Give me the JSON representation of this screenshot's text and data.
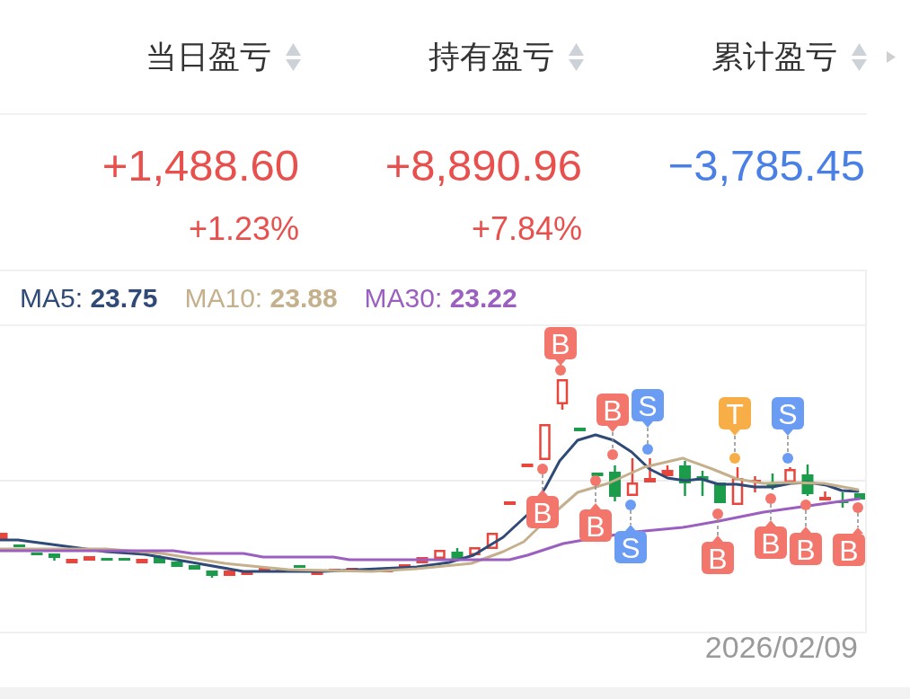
{
  "columns": [
    {
      "label": "当日盈亏",
      "value": "+1,488.60",
      "percent": "+1.23%",
      "color": "#e8504d"
    },
    {
      "label": "持有盈亏",
      "value": "+8,890.96",
      "percent": "+7.84%",
      "color": "#e8504d"
    },
    {
      "label": "累计盈亏",
      "value": "−3,785.45",
      "color": "#4a80e6"
    }
  ],
  "chart": {
    "ma_legend": [
      {
        "label": "MA5:",
        "value": "23.75",
        "color": "#2f4a77"
      },
      {
        "label": "MA10:",
        "value": "23.88",
        "color": "#c4b08c"
      },
      {
        "label": "MA30:",
        "value": "23.22",
        "color": "#9b5fbf"
      }
    ],
    "markers": [
      {
        "label": "B",
        "color": "#f2766c"
      },
      {
        "label": "B",
        "color": "#f2766c"
      },
      {
        "label": "B",
        "color": "#f2766c"
      },
      {
        "label": "B",
        "color": "#f2766c"
      },
      {
        "label": "S",
        "color": "#6a9cf3"
      },
      {
        "label": "S",
        "color": "#6a9cf3"
      },
      {
        "label": "B",
        "color": "#f2766c"
      },
      {
        "label": "T",
        "color": "#f7ae46"
      },
      {
        "label": "B",
        "color": "#f2766c"
      },
      {
        "label": "S",
        "color": "#6a9cf3"
      },
      {
        "label": "B",
        "color": "#f2766c"
      },
      {
        "label": "B",
        "color": "#f2766c"
      }
    ],
    "date": "2026/02/09"
  }
}
